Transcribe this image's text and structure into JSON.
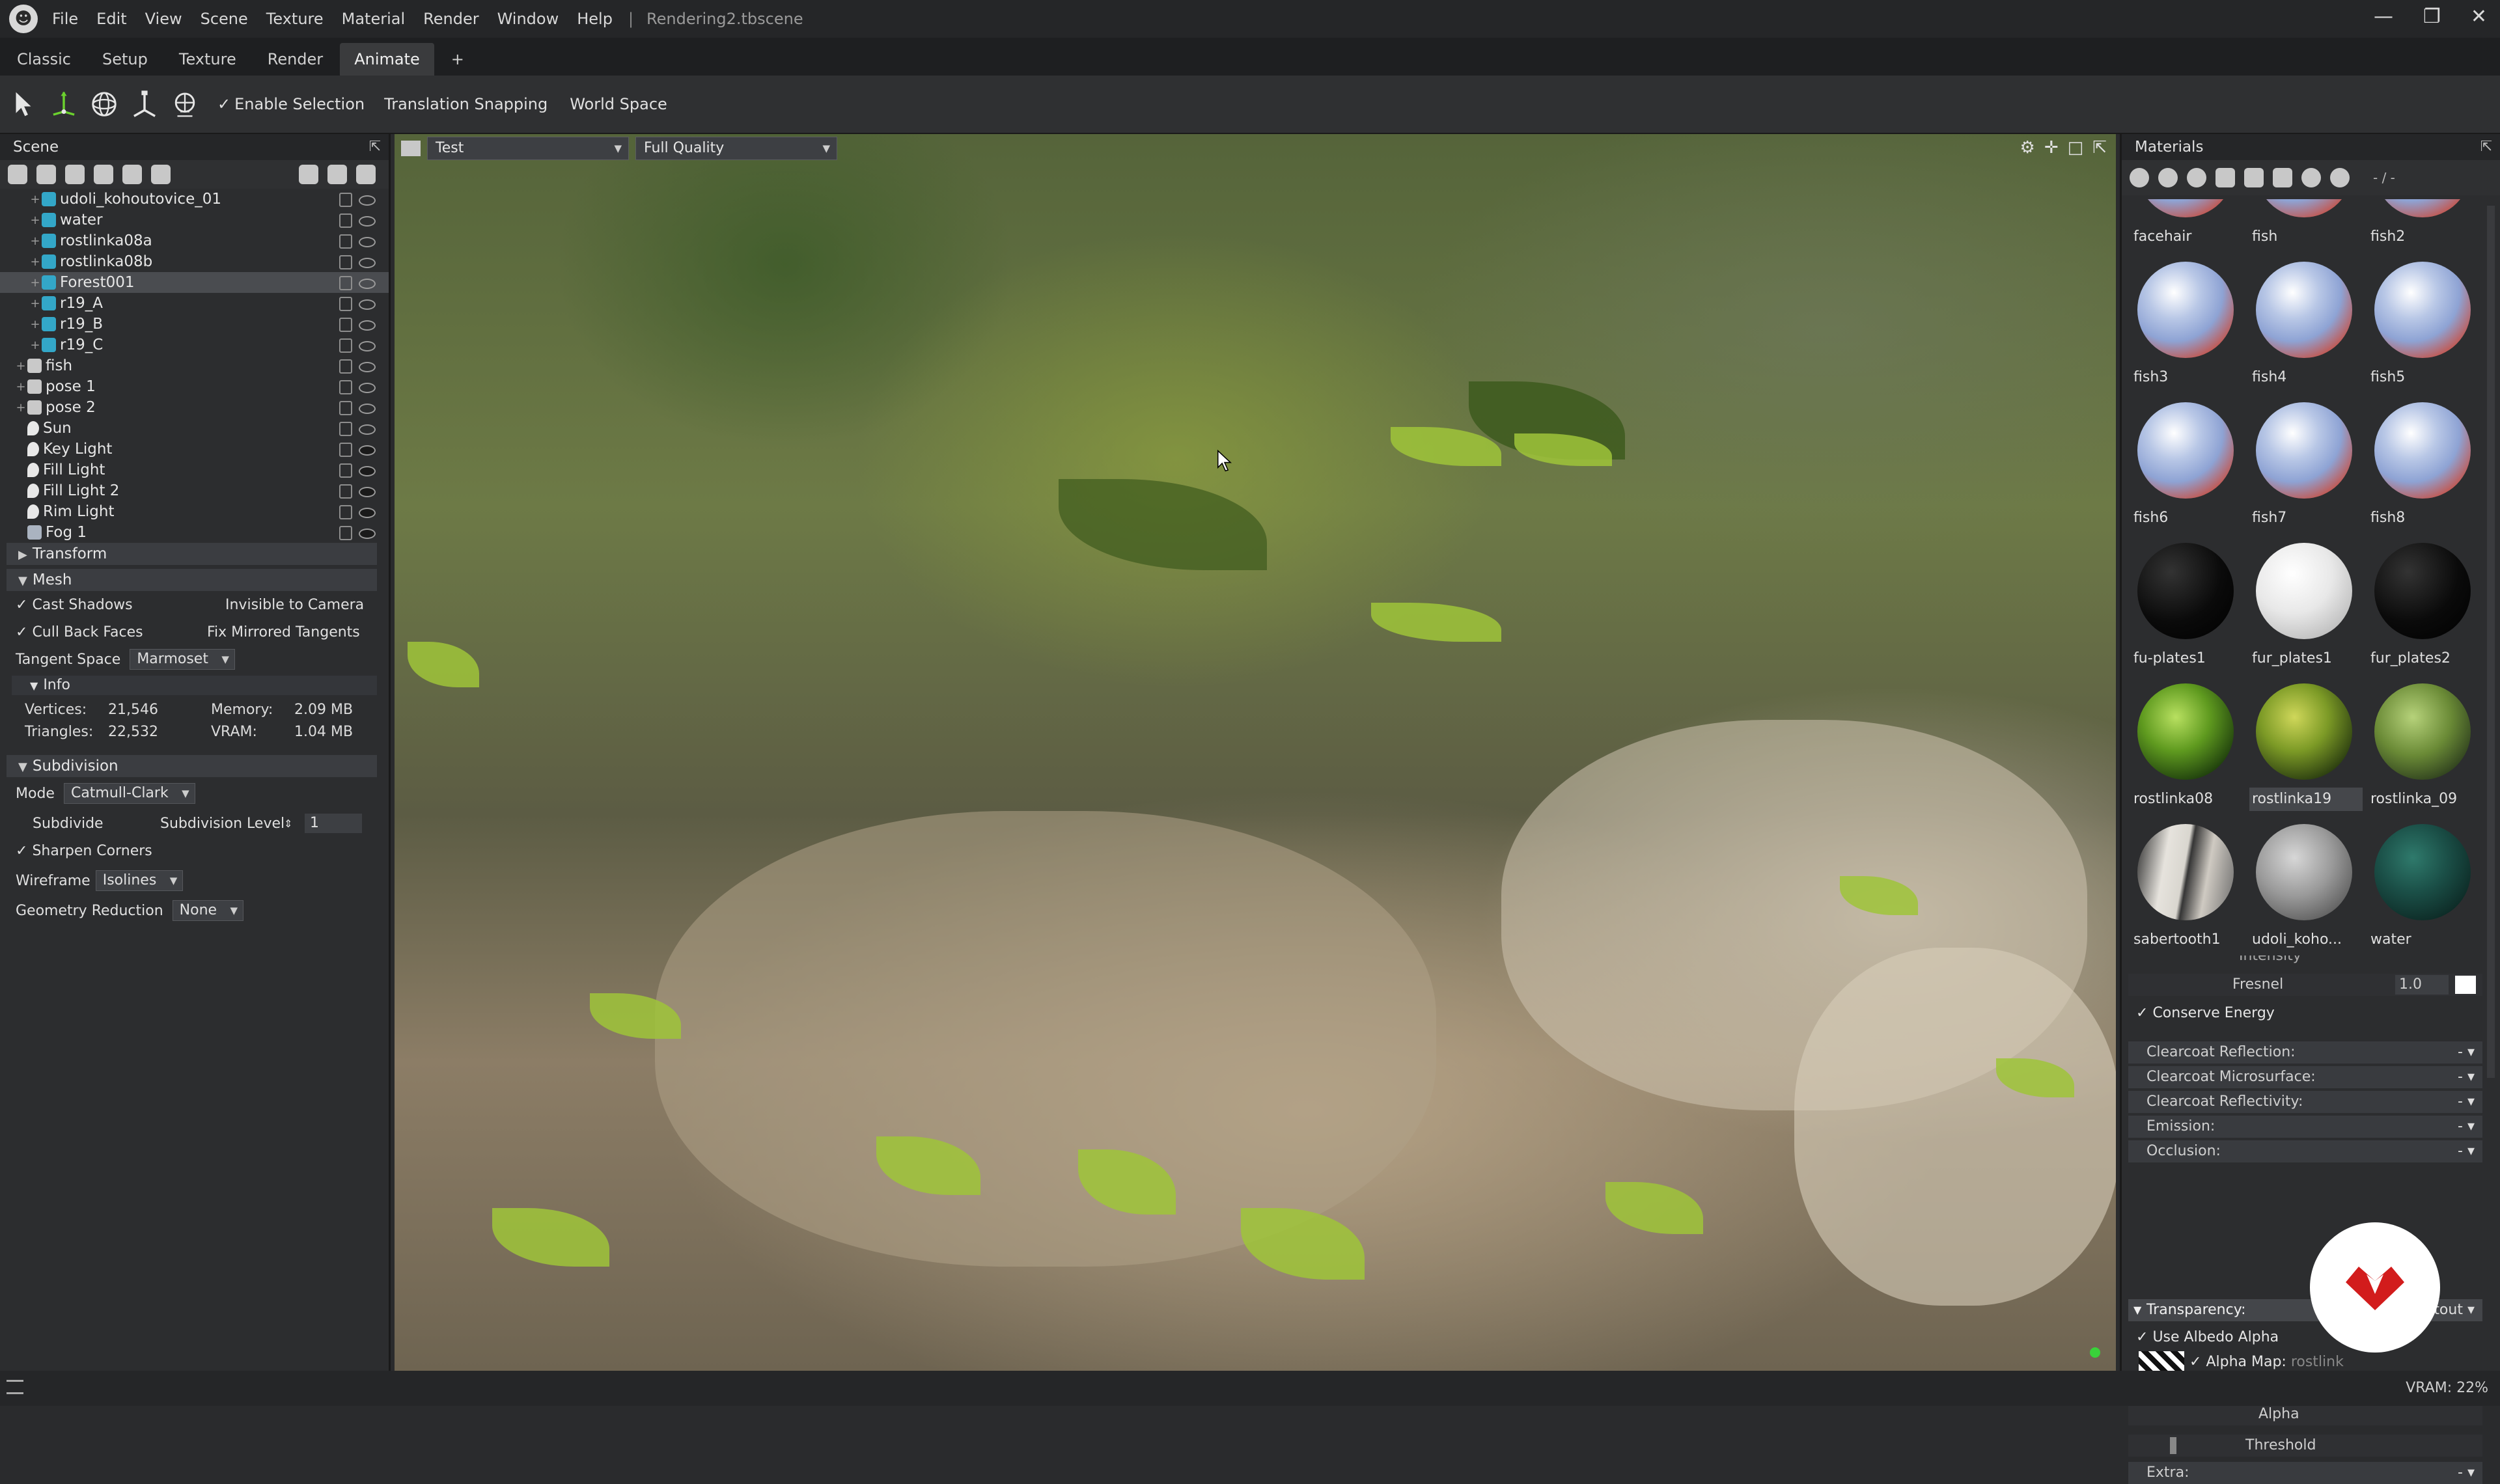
{
  "window": {
    "filename": "Rendering2.tbscene",
    "controls": [
      "—",
      "❐",
      "✕"
    ]
  },
  "menu": [
    "File",
    "Edit",
    "View",
    "Scene",
    "Texture",
    "Material",
    "Render",
    "Window",
    "Help"
  ],
  "tabs": [
    {
      "label": "Classic"
    },
    {
      "label": "Setup"
    },
    {
      "label": "Texture"
    },
    {
      "label": "Render"
    },
    {
      "label": "Animate",
      "active": true
    },
    {
      "label": "+"
    }
  ],
  "toolbar": {
    "enable_selection": "Enable Selection",
    "translation_snapping": "Translation Snapping",
    "world_space": "World Space"
  },
  "scene": {
    "title": "Scene",
    "tree": [
      {
        "label": "udoli_kohoutovice_01",
        "type": "mesh",
        "indent": 2
      },
      {
        "label": "water",
        "type": "mesh",
        "indent": 2
      },
      {
        "label": "rostlinka08a",
        "type": "mesh",
        "indent": 2
      },
      {
        "label": "rostlinka08b",
        "type": "mesh",
        "indent": 2
      },
      {
        "label": "Forest001",
        "type": "mesh",
        "indent": 2,
        "selected": true
      },
      {
        "label": "r19_A",
        "type": "mesh",
        "indent": 2
      },
      {
        "label": "r19_B",
        "type": "mesh",
        "indent": 2
      },
      {
        "label": "r19_C",
        "type": "mesh",
        "indent": 2
      },
      {
        "label": "fish",
        "type": "grp",
        "indent": 1
      },
      {
        "label": "pose 1",
        "type": "grp",
        "indent": 1
      },
      {
        "label": "pose 2",
        "type": "grp",
        "indent": 1
      },
      {
        "label": "Sun",
        "type": "light",
        "indent": 1
      },
      {
        "label": "Key Light",
        "type": "light",
        "indent": 1,
        "dark": true
      },
      {
        "label": "Fill Light",
        "type": "light",
        "indent": 1,
        "dark": true
      },
      {
        "label": "Fill Light 2",
        "type": "light",
        "indent": 1,
        "dark": true
      },
      {
        "label": "Rim Light",
        "type": "light",
        "indent": 1,
        "dark": true
      },
      {
        "label": "Fog 1",
        "type": "fog",
        "indent": 1,
        "dark": true
      }
    ]
  },
  "props": {
    "transform": "Transform",
    "mesh": "Mesh",
    "cast_shadows": "Cast Shadows",
    "invisible_to_camera": "Invisible to Camera",
    "cull_back_faces": "Cull Back Faces",
    "fix_mirrored_tangents": "Fix Mirrored Tangents",
    "tangent_space_label": "Tangent Space",
    "tangent_space_value": "Marmoset",
    "info": "Info",
    "vertices_label": "Vertices:",
    "vertices_value": "21,546",
    "triangles_label": "Triangles:",
    "triangles_value": "22,532",
    "memory_label": "Memory:",
    "memory_value": "2.09 MB",
    "vram_label": "VRAM:",
    "vram_value": "1.04 MB",
    "subdivision": "Subdivision",
    "mode_label": "Mode",
    "mode_value": "Catmull-Clark",
    "subdivide": "Subdivide",
    "subdivision_level_label": "Subdivision Level",
    "subdivision_level_value": "1",
    "sharpen_corners": "Sharpen Corners",
    "wireframe_label": "Wireframe",
    "wireframe_value": "Isolines",
    "geometry_reduction_label": "Geometry Reduction",
    "geometry_reduction_value": "None"
  },
  "viewport": {
    "camera": "Test",
    "quality": "Full Quality"
  },
  "materials": {
    "title": "Materials",
    "count_label": "- / -",
    "items": [
      {
        "name": "facehair",
        "style": "fish",
        "partial": true
      },
      {
        "name": "fish",
        "style": "fish",
        "partial": true
      },
      {
        "name": "fish2",
        "style": "fish",
        "partial": true
      },
      {
        "name": "fish3",
        "style": "fish"
      },
      {
        "name": "fish4",
        "style": "fish"
      },
      {
        "name": "fish5",
        "style": "fish"
      },
      {
        "name": "fish6",
        "style": "fish"
      },
      {
        "name": "fish7",
        "style": "fish"
      },
      {
        "name": "fish8",
        "style": "fish"
      },
      {
        "name": "fu-plates1",
        "style": "black"
      },
      {
        "name": "fur_plates1",
        "style": "white"
      },
      {
        "name": "fur_plates2",
        "style": "black"
      },
      {
        "name": "rostlinka08",
        "style": "leafball"
      },
      {
        "name": "rostlinka19",
        "style": "leafball2",
        "selected": true
      },
      {
        "name": "rostlinka_09",
        "style": "leafball3"
      },
      {
        "name": "sabertooth1",
        "style": "tooth"
      },
      {
        "name": "udoli_koho...",
        "style": "stone"
      },
      {
        "name": "water",
        "style": "waterb"
      }
    ],
    "intensity_label": "Intensity",
    "fresnel_label": "Fresnel",
    "fresnel_value": "1.0",
    "conserve_energy": "Conserve Energy",
    "sections": [
      {
        "label": "Clearcoat Reflection:",
        "value": "- ▾"
      },
      {
        "label": "Clearcoat Microsurface:",
        "value": "- ▾"
      },
      {
        "label": "Clearcoat Reflectivity:",
        "value": "- ▾"
      },
      {
        "label": "Emission:",
        "value": "- ▾"
      },
      {
        "label": "Occlusion:",
        "value": "- ▾"
      }
    ],
    "transparency_label": "Transparency:",
    "transparency_value": "Cutout",
    "use_albedo_alpha": "Use Albedo Alpha",
    "alpha_map_label": "Alpha Map:",
    "alpha_map_value": "rostlink",
    "alpha_label": "Alpha",
    "threshold_label": "Threshold",
    "extra_label": "Extra:",
    "extra_value": "- ▾"
  },
  "status": {
    "vram": "VRAM: 22%"
  }
}
